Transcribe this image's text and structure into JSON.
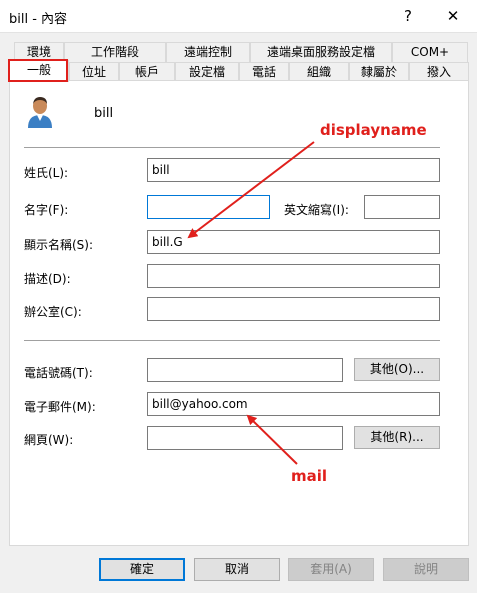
{
  "window": {
    "title": "bill - 內容",
    "help_glyph": "?",
    "close_glyph": "✕"
  },
  "tabs_top": [
    "環境",
    "工作階段",
    "遠端控制",
    "遠端桌面服務設定檔",
    "COM+"
  ],
  "tabs_bottom": [
    "一般",
    "位址",
    "帳戶",
    "設定檔",
    "電話",
    "組織",
    "隸屬於",
    "撥入"
  ],
  "header": {
    "account_name": "bill"
  },
  "fields": {
    "last_name": {
      "label": "姓氏(L):",
      "value": "bill"
    },
    "first_name": {
      "label": "名字(F):",
      "value": ""
    },
    "initials": {
      "label": "英文縮寫(I):",
      "value": ""
    },
    "display_name": {
      "label": "顯示名稱(S):",
      "value": "bill.G"
    },
    "description": {
      "label": "描述(D):",
      "value": ""
    },
    "office": {
      "label": "辦公室(C):",
      "value": ""
    },
    "phone": {
      "label": "電話號碼(T):",
      "value": "",
      "other_button": "其他(O)..."
    },
    "email": {
      "label": "電子郵件(M):",
      "value": "bill@yahoo.com"
    },
    "webpage": {
      "label": "網頁(W):",
      "value": "",
      "other_button": "其他(R)..."
    }
  },
  "annotations": {
    "display_name": "displayname",
    "mail": "mail"
  },
  "buttons": {
    "ok": "確定",
    "cancel": "取消",
    "apply": "套用(A)",
    "help": "說明"
  },
  "colors": {
    "annotation": "#e0201c",
    "focus": "#0078d7",
    "highlight_box": "#e0201c"
  },
  "icons": {
    "user": "user-icon"
  }
}
